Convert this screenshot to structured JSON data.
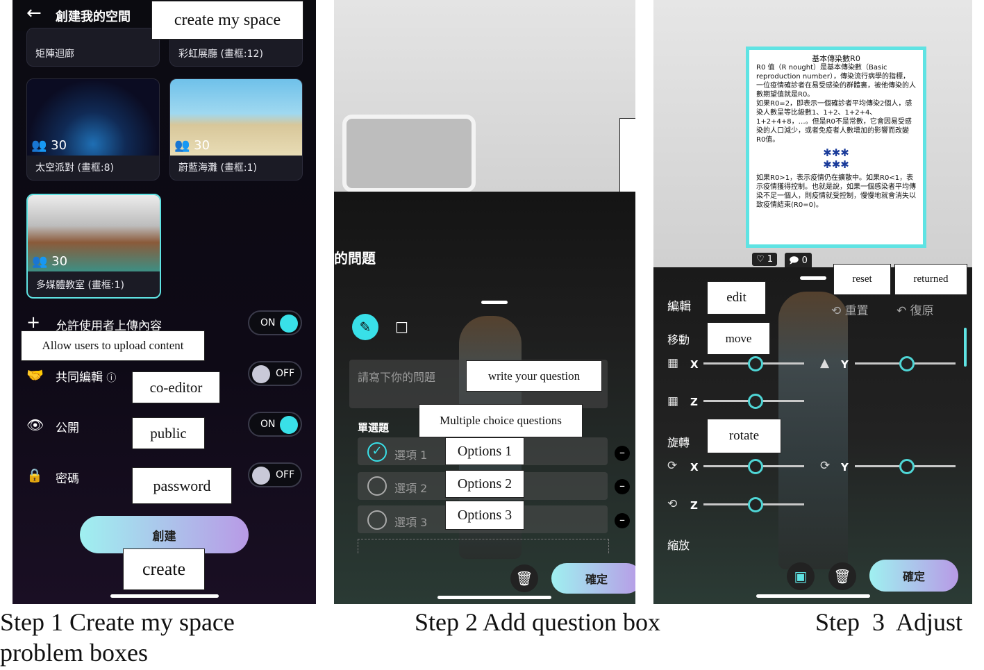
{
  "colors": {
    "accent": "#39e0e8",
    "toggle_on": "#39e0e8",
    "toggle_off": "#c9c9d8",
    "button_grad_start": "#9ff0f0",
    "button_grad_end": "#b89ae6",
    "panel_dark": "#101018"
  },
  "step1": {
    "header_title": "創建我的空間",
    "back_icon": "back-arrow-icon",
    "rooms": [
      {
        "name": "矩陣迴廊"
      },
      {
        "name": "彩虹展廳 (畫框:12)"
      },
      {
        "name": "太空派對 (畫框:8)",
        "count": "30"
      },
      {
        "name": "蔚藍海灘 (畫框:1)",
        "count": "30"
      },
      {
        "name": "多媒體教室 (畫框:1)",
        "count": "30"
      }
    ],
    "upload_label": "允許使用者上傳內容",
    "upload_state": "ON",
    "coedit_label": "共同編輯",
    "coedit_state": "OFF",
    "public_label": "公開",
    "public_state": "ON",
    "password_label": "密碼",
    "password_state": "OFF",
    "create_button": "創建",
    "annotations": {
      "create_space": "create my space",
      "allow_upload": "Allow users to upload content",
      "coeditor": "co-editor",
      "public": "public",
      "password": "password",
      "create": "create"
    }
  },
  "step2": {
    "dialog_title": "的問題",
    "question_placeholder": "請寫下你的問題",
    "single_choice": "單選題",
    "options": [
      "選項 1",
      "選項 2",
      "選項 3"
    ],
    "confirm_button": "確定",
    "annotations": {
      "write_question": "write your question",
      "multiple_choice": "Multiple choice questions",
      "options": [
        "Options 1",
        "Options 2",
        "Options 3"
      ]
    }
  },
  "step3": {
    "board_title": "基本傳染數R0",
    "board_body1": "R0 值（R nought）是基本傳染數（Basic reproduction number），傳染流行病學的指標，一位疫情確診者在易受感染的群體裏，被他傳染的人數期望值就是R0。",
    "board_body2": "如果R0=2，即表示一個確診者平均傳染2個人，感染人數呈等比級數1、1+2、1+2+4、1+2+4+8，…。但是R0不是常數，它會因易受感染的人口減少，或者免疫者人數增加的影響而改變R0值。",
    "board_body3": "如果R0>1，表示疫情仍在擴散中。如果R0<1，表示疫情獲得控制。也就是說，如果一個感染者平均傳染不足一個人，則疫情就受控制，慢慢地就會消失以致疫情結束(R0=0)。",
    "likes": "1",
    "comments": "0",
    "edit_label": "編輯",
    "reset_label": "重置",
    "restore_label": "復原",
    "move_label": "移動",
    "rotate_label": "旋轉",
    "scale_label": "縮放",
    "axis_x": "X",
    "axis_y": "Y",
    "axis_z": "Z",
    "confirm_button": "確定",
    "annotations": {
      "reset": "reset",
      "returned": "returned",
      "edit": "edit",
      "move": "move",
      "rotate": "rotate"
    }
  },
  "captions": {
    "step1_line1": "Step 1 Create my space",
    "step1_line2": "problem boxes",
    "step2": "Step 2 Add question box",
    "step3": "Step  3  Adjust"
  }
}
